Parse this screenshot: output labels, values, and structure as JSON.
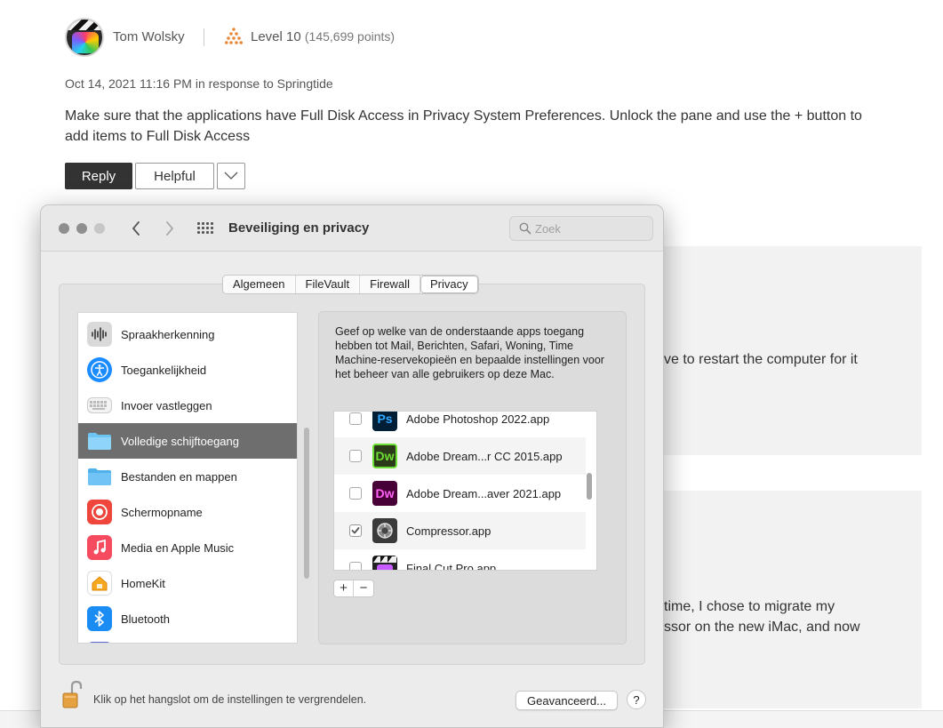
{
  "post": {
    "author": "Tom Wolsky",
    "level": "Level 10",
    "points": "(145,699 points)",
    "meta": "Oct 14, 2021 11:16 PM in response to Springtide",
    "body": "Make sure that the applications have Full Disk Access in Privacy System Preferences. Unlock the pane and use the + button to add items to Full Disk Access",
    "reply_label": "Reply",
    "helpful_label": "Helpful"
  },
  "background": {
    "text_1": "ve to restart the computer for it",
    "text_2_line1": "time, I chose to migrate my",
    "text_2_line2": "ssor on the new iMac, and now"
  },
  "window": {
    "title": "Beveiliging en privacy",
    "search_placeholder": "Zoek",
    "tabs": [
      {
        "label": "Algemeen"
      },
      {
        "label": "FileVault"
      },
      {
        "label": "Firewall"
      },
      {
        "label": "Privacy"
      }
    ],
    "active_tab": "Privacy",
    "sidebar": [
      {
        "label": "Spraakherkenning",
        "icon": "waveform-icon"
      },
      {
        "label": "Toegankelijkheid",
        "icon": "accessibility-icon"
      },
      {
        "label": "Invoer vastleggen",
        "icon": "keyboard-icon"
      },
      {
        "label": "Volledige schijftoegang",
        "icon": "folder-icon"
      },
      {
        "label": "Bestanden en mappen",
        "icon": "folder-icon"
      },
      {
        "label": "Schermopname",
        "icon": "screen-record-icon"
      },
      {
        "label": "Media en Apple Music",
        "icon": "music-note-icon"
      },
      {
        "label": "HomeKit",
        "icon": "home-icon"
      },
      {
        "label": "Bluetooth",
        "icon": "bluetooth-icon"
      }
    ],
    "selected_sidebar": "Volledige schijftoegang",
    "description": "Geef op welke van de onderstaande apps toegang hebben tot Mail, Berichten, Safari, Woning, Time Machine-reservekopieën en bepaalde instellingen voor het beheer van alle gebruikers op deze Mac.",
    "apps": [
      {
        "name": "Adobe Photoshop 2022.app",
        "badge": "Ps",
        "checked": false
      },
      {
        "name": "Adobe Dream...r CC 2015.app",
        "badge": "Dw",
        "checked": false
      },
      {
        "name": "Adobe Dream...aver 2021.app",
        "badge": "Dw",
        "checked": false
      },
      {
        "name": "Compressor.app",
        "badge": "",
        "checked": true
      },
      {
        "name": "Final Cut Pro.app",
        "badge": "",
        "checked": false
      }
    ],
    "add_label": "+",
    "remove_label": "−",
    "lock_text": "Klik op het hangslot om de instellingen te vergrendelen.",
    "advanced_label": "Geavanceerd...",
    "help_label": "?"
  },
  "colors": {
    "selection": "#6e6e6e",
    "reply_bg": "#333333",
    "level_orange": "#e8893a"
  }
}
